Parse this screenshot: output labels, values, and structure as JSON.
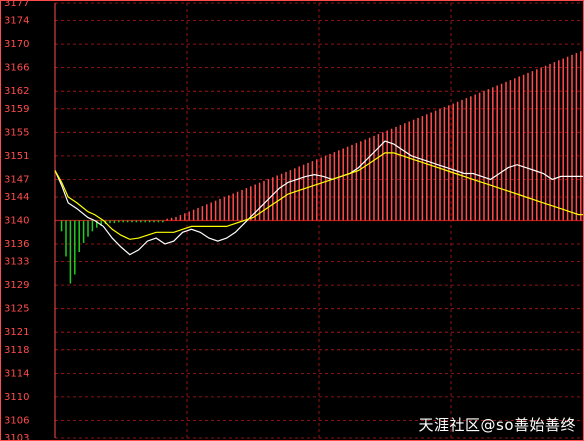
{
  "chart_data": {
    "type": "intraday-line",
    "y_ticks": [
      3177,
      3174,
      3170,
      3166,
      3162,
      3159,
      3155,
      3151,
      3147,
      3144,
      3140,
      3136,
      3133,
      3129,
      3125,
      3121,
      3118,
      3114,
      3110,
      3106,
      3103
    ],
    "ylim": [
      3103,
      3177
    ],
    "baseline": 3140,
    "x_slots": 240,
    "grid": true,
    "colors": {
      "up": "#ff4d4d",
      "down": "#22cc22",
      "price": "#ffffff",
      "avg": "#ffff00",
      "grid": "#b81818",
      "border": "#ff4d4d"
    },
    "series": [
      {
        "color": "#ffffff",
        "points": [
          [
            0,
            3148.5
          ],
          [
            3,
            3146
          ],
          [
            6,
            3143
          ],
          [
            10,
            3142
          ],
          [
            15,
            3140.5
          ],
          [
            18,
            3140
          ],
          [
            22,
            3139
          ],
          [
            26,
            3137
          ],
          [
            30,
            3135.5
          ],
          [
            34,
            3134.2
          ],
          [
            38,
            3135
          ],
          [
            42,
            3136.5
          ],
          [
            46,
            3137
          ],
          [
            50,
            3136
          ],
          [
            54,
            3136.5
          ],
          [
            58,
            3138
          ],
          [
            62,
            3138.5
          ],
          [
            66,
            3138
          ],
          [
            70,
            3137
          ],
          [
            74,
            3136.5
          ],
          [
            78,
            3137
          ],
          [
            82,
            3138
          ],
          [
            86,
            3139.5
          ],
          [
            90,
            3141
          ],
          [
            94,
            3142.5
          ],
          [
            98,
            3144
          ],
          [
            102,
            3145.5
          ],
          [
            106,
            3146.5
          ],
          [
            110,
            3147
          ],
          [
            114,
            3147.5
          ],
          [
            118,
            3147.8
          ],
          [
            122,
            3147.5
          ],
          [
            126,
            3147
          ],
          [
            130,
            3147.5
          ],
          [
            134,
            3148
          ],
          [
            138,
            3149
          ],
          [
            142,
            3150.5
          ],
          [
            146,
            3152
          ],
          [
            150,
            3153.5
          ],
          [
            154,
            3153
          ],
          [
            158,
            3152
          ],
          [
            162,
            3151
          ],
          [
            166,
            3150.5
          ],
          [
            170,
            3150
          ],
          [
            174,
            3149.5
          ],
          [
            178,
            3149
          ],
          [
            182,
            3148.5
          ],
          [
            186,
            3148
          ],
          [
            190,
            3148
          ],
          [
            194,
            3147.5
          ],
          [
            198,
            3147
          ],
          [
            202,
            3148
          ],
          [
            206,
            3149
          ],
          [
            210,
            3149.5
          ],
          [
            214,
            3149
          ],
          [
            218,
            3148.5
          ],
          [
            222,
            3148
          ],
          [
            226,
            3147
          ],
          [
            230,
            3147.5
          ],
          [
            234,
            3147.5
          ],
          [
            238,
            3147.5
          ],
          [
            240,
            3147.5
          ]
        ]
      },
      {
        "color": "#ffff00",
        "points": [
          [
            0,
            3148.5
          ],
          [
            3,
            3146.5
          ],
          [
            6,
            3144
          ],
          [
            10,
            3143
          ],
          [
            15,
            3141.5
          ],
          [
            18,
            3141
          ],
          [
            22,
            3140
          ],
          [
            26,
            3138.5
          ],
          [
            30,
            3137.5
          ],
          [
            34,
            3136.8
          ],
          [
            38,
            3137
          ],
          [
            42,
            3137.5
          ],
          [
            46,
            3138
          ],
          [
            50,
            3138
          ],
          [
            54,
            3138
          ],
          [
            58,
            3138.5
          ],
          [
            62,
            3139
          ],
          [
            66,
            3139
          ],
          [
            70,
            3139
          ],
          [
            74,
            3139
          ],
          [
            78,
            3139
          ],
          [
            82,
            3139.5
          ],
          [
            86,
            3140
          ],
          [
            90,
            3140.5
          ],
          [
            94,
            3141.5
          ],
          [
            98,
            3142.5
          ],
          [
            102,
            3143.5
          ],
          [
            106,
            3144.5
          ],
          [
            110,
            3145
          ],
          [
            114,
            3145.5
          ],
          [
            118,
            3146
          ],
          [
            122,
            3146.5
          ],
          [
            126,
            3147
          ],
          [
            130,
            3147.5
          ],
          [
            134,
            3148
          ],
          [
            138,
            3148.5
          ],
          [
            142,
            3149.5
          ],
          [
            146,
            3150.5
          ],
          [
            150,
            3151.5
          ],
          [
            154,
            3151.5
          ],
          [
            158,
            3151
          ],
          [
            162,
            3150.5
          ],
          [
            166,
            3150
          ],
          [
            170,
            3149.5
          ],
          [
            174,
            3149
          ],
          [
            178,
            3148.5
          ],
          [
            182,
            3148
          ],
          [
            186,
            3147.5
          ],
          [
            190,
            3147
          ],
          [
            194,
            3146.5
          ],
          [
            198,
            3146
          ],
          [
            202,
            3145.5
          ],
          [
            206,
            3145
          ],
          [
            210,
            3144.5
          ],
          [
            214,
            3144
          ],
          [
            218,
            3143.5
          ],
          [
            222,
            3143
          ],
          [
            226,
            3142.5
          ],
          [
            230,
            3142
          ],
          [
            234,
            3141.5
          ],
          [
            238,
            3141
          ],
          [
            240,
            3141
          ]
        ]
      }
    ],
    "volume_bars": [
      [
        3,
        -12
      ],
      [
        5,
        -40
      ],
      [
        7,
        -70
      ],
      [
        9,
        -60
      ],
      [
        11,
        -35
      ],
      [
        13,
        -25
      ],
      [
        15,
        -18
      ],
      [
        17,
        -12
      ],
      [
        19,
        -8
      ],
      [
        21,
        -6
      ],
      [
        23,
        -4
      ],
      [
        25,
        -3
      ],
      [
        27,
        -3
      ],
      [
        29,
        -2
      ],
      [
        31,
        -2
      ],
      [
        33,
        -2
      ],
      [
        35,
        -2
      ],
      [
        37,
        -2
      ],
      [
        39,
        -2
      ],
      [
        41,
        -2
      ],
      [
        43,
        -2
      ],
      [
        45,
        -2
      ],
      [
        47,
        -2
      ],
      [
        49,
        -2
      ],
      [
        51,
        2
      ],
      [
        53,
        3
      ],
      [
        55,
        4
      ],
      [
        57,
        6
      ],
      [
        59,
        8
      ],
      [
        61,
        10
      ],
      [
        63,
        12
      ],
      [
        65,
        14
      ],
      [
        67,
        16
      ],
      [
        69,
        18
      ],
      [
        71,
        20
      ],
      [
        73,
        22
      ],
      [
        75,
        24
      ],
      [
        77,
        26
      ],
      [
        79,
        28
      ],
      [
        81,
        30
      ],
      [
        83,
        32
      ],
      [
        85,
        34
      ],
      [
        87,
        36
      ],
      [
        89,
        38
      ],
      [
        91,
        40
      ],
      [
        93,
        42
      ],
      [
        95,
        44
      ],
      [
        97,
        46
      ],
      [
        99,
        48
      ],
      [
        101,
        50
      ],
      [
        103,
        52
      ],
      [
        105,
        54
      ],
      [
        107,
        56
      ],
      [
        109,
        58
      ],
      [
        111,
        60
      ],
      [
        113,
        62
      ],
      [
        115,
        64
      ],
      [
        117,
        66
      ],
      [
        119,
        68
      ],
      [
        121,
        70
      ],
      [
        123,
        72
      ],
      [
        125,
        74
      ],
      [
        127,
        76
      ],
      [
        129,
        78
      ],
      [
        131,
        80
      ],
      [
        133,
        82
      ],
      [
        135,
        84
      ],
      [
        137,
        86
      ],
      [
        139,
        88
      ],
      [
        141,
        90
      ],
      [
        143,
        92
      ],
      [
        145,
        94
      ],
      [
        147,
        96
      ],
      [
        149,
        98
      ],
      [
        151,
        100
      ],
      [
        153,
        102
      ],
      [
        155,
        104
      ],
      [
        157,
        106
      ],
      [
        159,
        108
      ],
      [
        161,
        110
      ],
      [
        163,
        112
      ],
      [
        165,
        114
      ],
      [
        167,
        116
      ],
      [
        169,
        118
      ],
      [
        171,
        120
      ],
      [
        173,
        122
      ],
      [
        175,
        124
      ],
      [
        177,
        126
      ],
      [
        179,
        128
      ],
      [
        181,
        130
      ],
      [
        183,
        132
      ],
      [
        185,
        134
      ],
      [
        187,
        136
      ],
      [
        189,
        138
      ],
      [
        191,
        140
      ],
      [
        193,
        142
      ],
      [
        195,
        144
      ],
      [
        197,
        146
      ],
      [
        199,
        148
      ],
      [
        201,
        150
      ],
      [
        203,
        152
      ],
      [
        205,
        154
      ],
      [
        207,
        156
      ],
      [
        209,
        158
      ],
      [
        211,
        160
      ],
      [
        213,
        162
      ],
      [
        215,
        164
      ],
      [
        217,
        166
      ],
      [
        219,
        168
      ],
      [
        221,
        170
      ],
      [
        223,
        172
      ],
      [
        225,
        174
      ],
      [
        227,
        176
      ],
      [
        229,
        178
      ],
      [
        231,
        180
      ],
      [
        233,
        182
      ],
      [
        235,
        184
      ],
      [
        237,
        186
      ],
      [
        239,
        188
      ]
    ]
  },
  "watermark": "天涯社区@so善始善终"
}
